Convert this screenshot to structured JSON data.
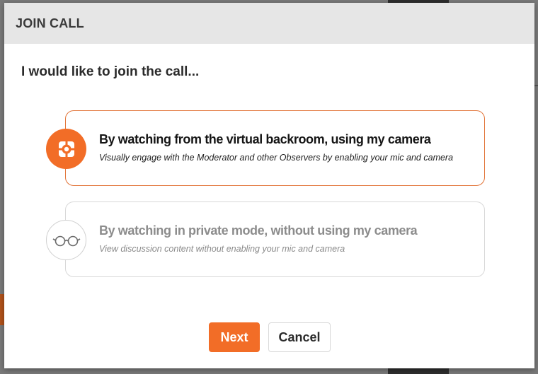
{
  "dialog": {
    "title": "JOIN CALL",
    "prompt": "I would like to join the call...",
    "options": [
      {
        "title": "By watching from the virtual backroom, using my camera",
        "description": "Visually engage with the Moderator and other Observers by enabling your mic and camera",
        "icon": "camera-lens-icon",
        "selected": true
      },
      {
        "title": "By watching in private mode, without using my camera",
        "description": "View discussion content without enabling your mic and camera",
        "icon": "glasses-icon",
        "selected": false
      }
    ],
    "buttons": {
      "next_label": "Next",
      "cancel_label": "Cancel"
    }
  },
  "colors": {
    "accent": "#f26d27",
    "header_bg": "#e6e6e6",
    "overlay": "#7a7a7a"
  }
}
